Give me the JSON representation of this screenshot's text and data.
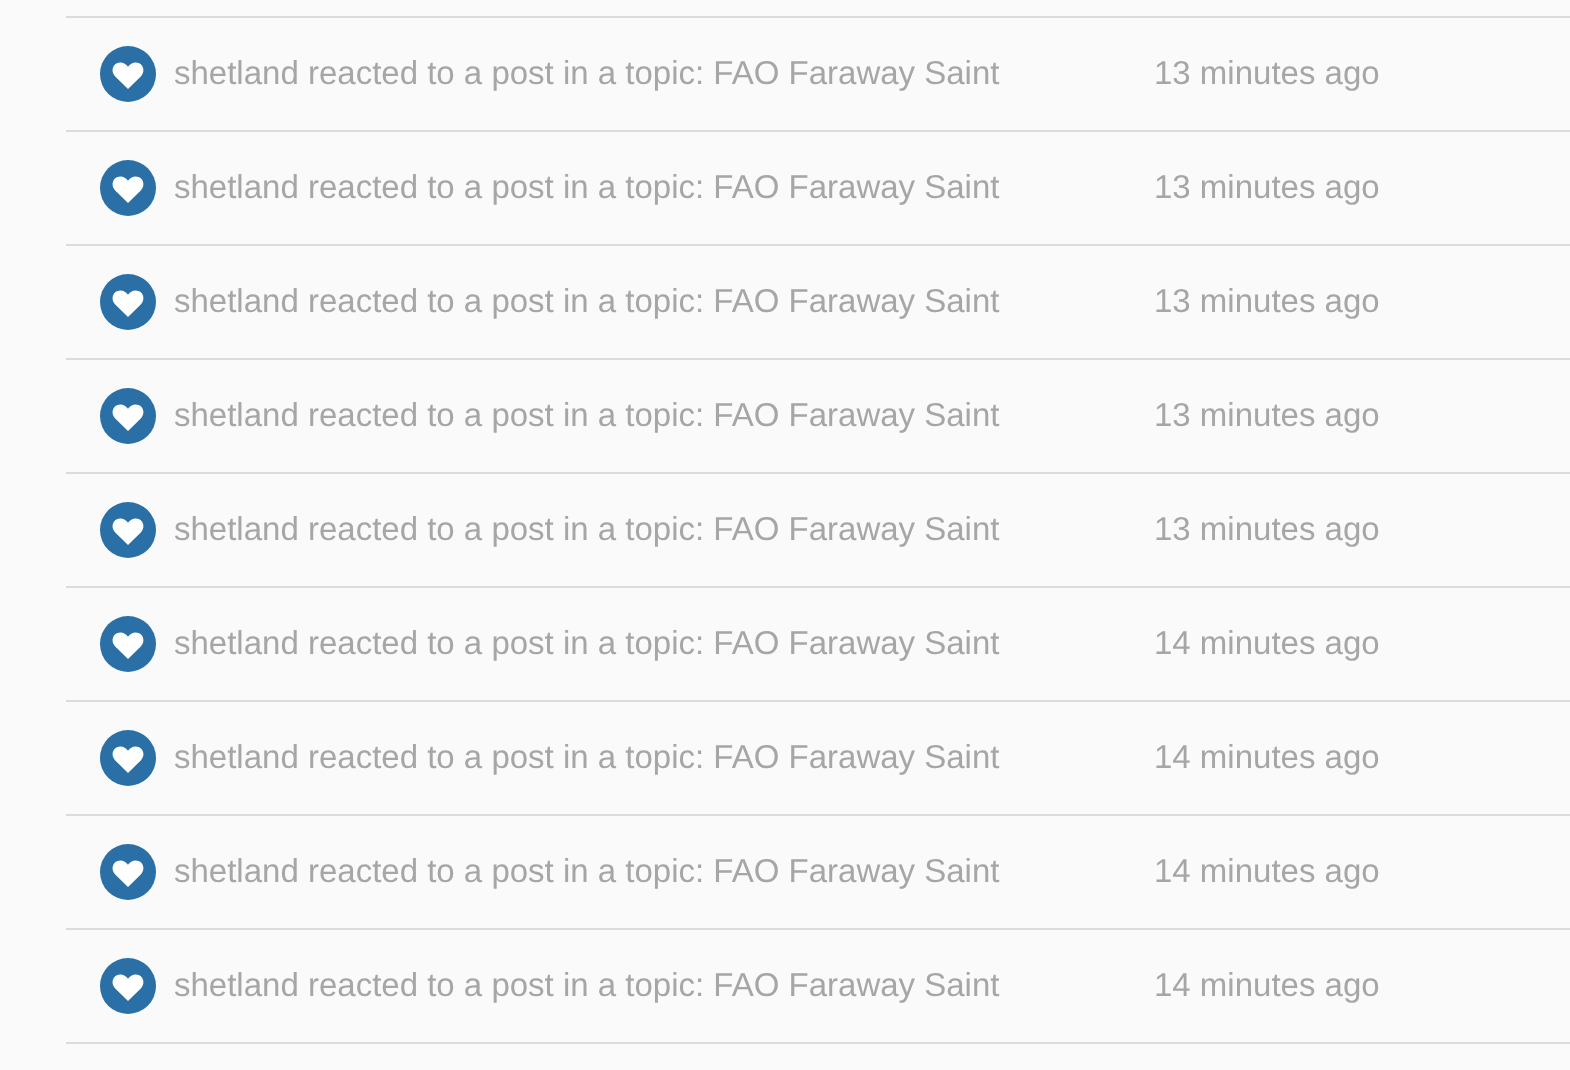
{
  "notifications": [
    {
      "text": "shetland reacted to a post in a topic: FAO Faraway Saint",
      "time": "13 minutes ago"
    },
    {
      "text": "shetland reacted to a post in a topic: FAO Faraway Saint",
      "time": "13 minutes ago"
    },
    {
      "text": "shetland reacted to a post in a topic: FAO Faraway Saint",
      "time": "13 minutes ago"
    },
    {
      "text": "shetland reacted to a post in a topic: FAO Faraway Saint",
      "time": "13 minutes ago"
    },
    {
      "text": "shetland reacted to a post in a topic: FAO Faraway Saint",
      "time": "13 minutes ago"
    },
    {
      "text": "shetland reacted to a post in a topic: FAO Faraway Saint",
      "time": "14 minutes ago"
    },
    {
      "text": "shetland reacted to a post in a topic: FAO Faraway Saint",
      "time": "14 minutes ago"
    },
    {
      "text": "shetland reacted to a post in a topic: FAO Faraway Saint",
      "time": "14 minutes ago"
    },
    {
      "text": "shetland reacted to a post in a topic: FAO Faraway Saint",
      "time": "14 minutes ago"
    }
  ]
}
